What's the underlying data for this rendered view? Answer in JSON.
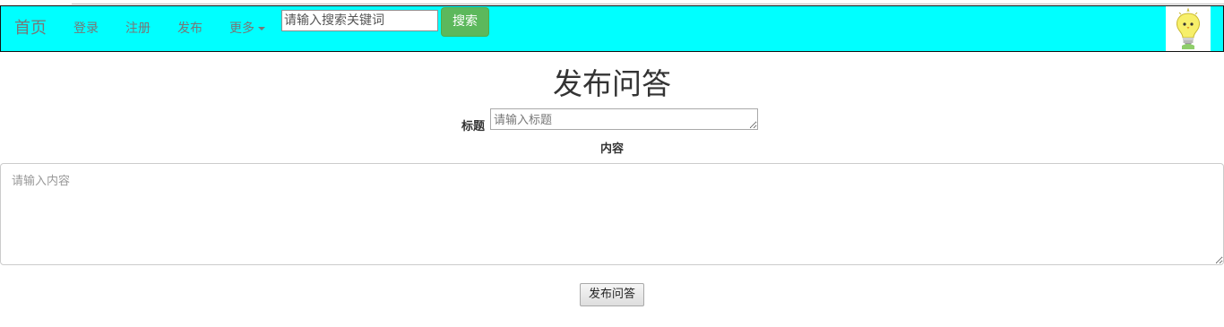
{
  "navbar": {
    "brand": "首页",
    "links": {
      "login": "登录",
      "register": "注册",
      "publish": "发布",
      "more": "更多"
    },
    "search": {
      "placeholder": "请输入搜索关键词",
      "button_label": "搜索"
    },
    "avatar_icon": "lightbulb-bird-icon"
  },
  "form": {
    "heading": "发布问答",
    "title_label": "标题",
    "title_placeholder": "请输入标题",
    "content_label": "内容",
    "content_placeholder": "请输入内容",
    "submit_label": "发布问答"
  },
  "colors": {
    "navbar_bg": "#00ffff",
    "search_button": "#5cb85c",
    "nav_text": "#777777"
  }
}
